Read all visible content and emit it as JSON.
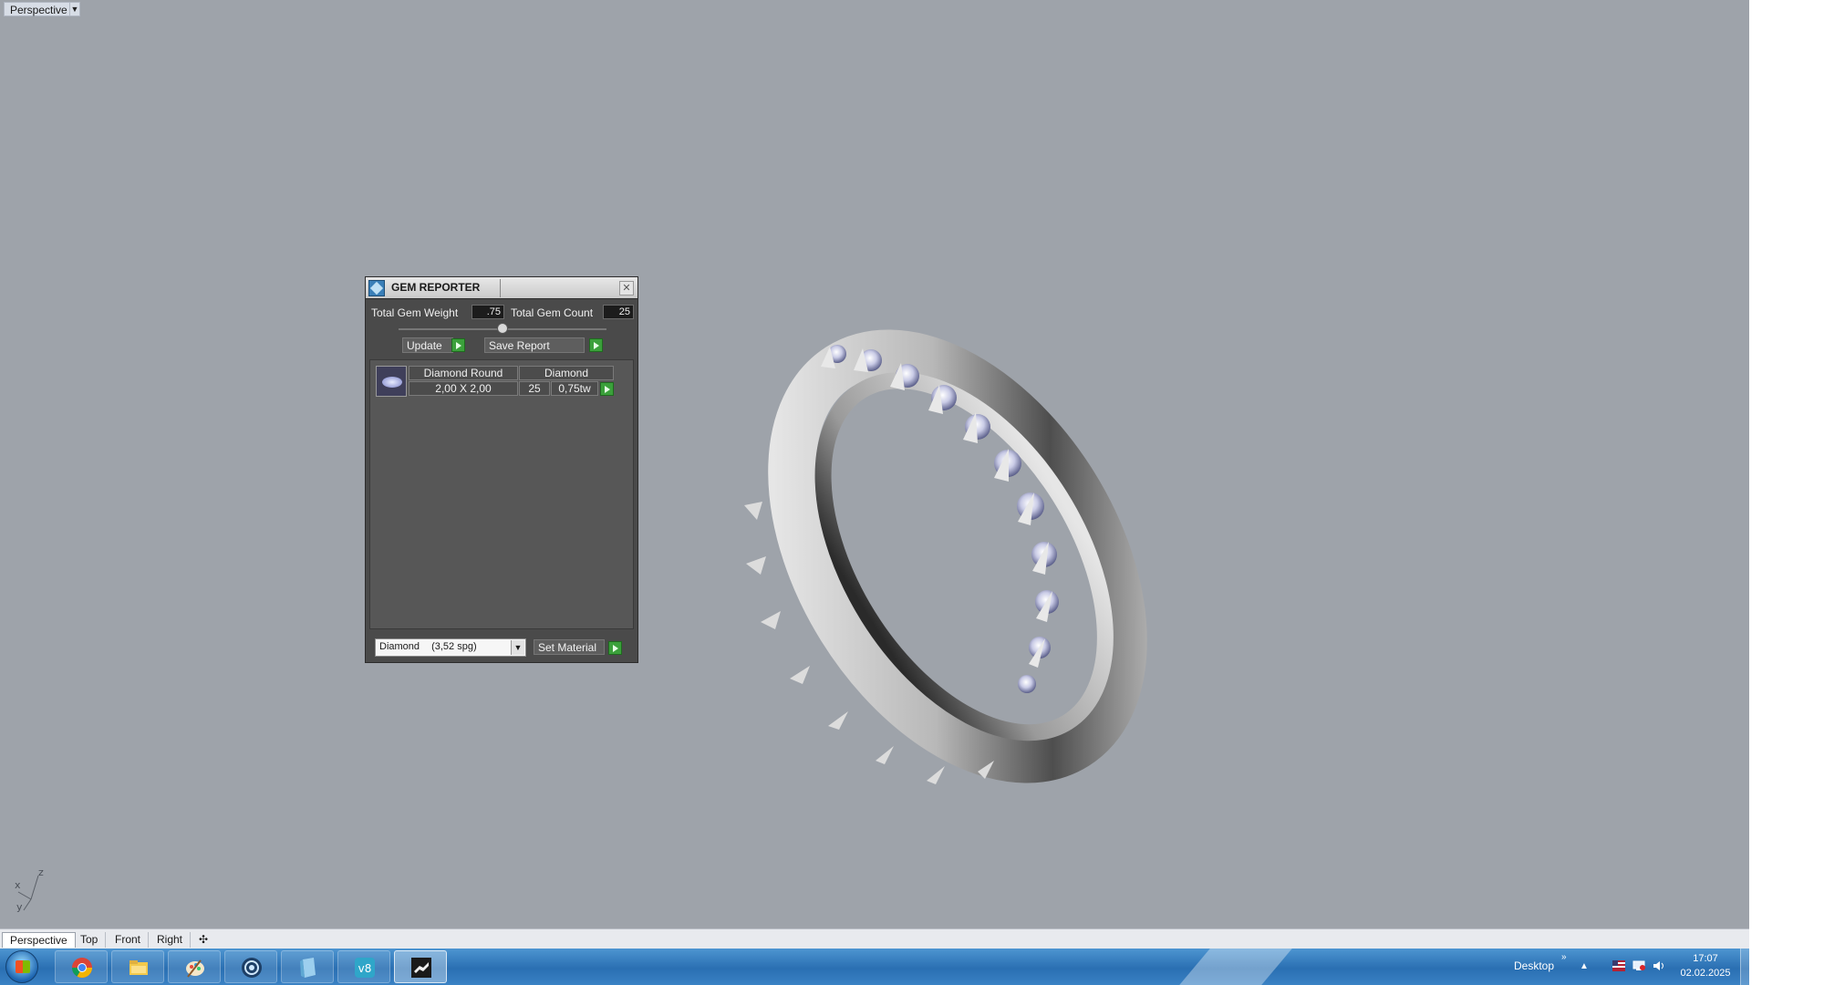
{
  "viewport": {
    "label": "Perspective",
    "axes": {
      "z": "z",
      "x": "x",
      "y": "y"
    }
  },
  "gem_reporter": {
    "title": "GEM REPORTER",
    "total_weight_label": "Total Gem Weight",
    "total_weight_value": ".75",
    "total_count_label": "Total Gem Count",
    "total_count_value": "25",
    "update_label": "Update",
    "save_report_label": "Save Report",
    "rows": [
      {
        "shape": "Diamond Round",
        "size": "2,00 X 2,00",
        "material": "Diamond",
        "count": "25",
        "weight": "0,75tw"
      }
    ],
    "material_select": {
      "name": "Diamond",
      "density": "(3,52 spg)"
    },
    "set_material_label": "Set Material"
  },
  "tabs": [
    "Perspective",
    "Top",
    "Front",
    "Right"
  ],
  "taskbar": {
    "apps": [
      "windows-start",
      "chrome",
      "file-explorer",
      "paint",
      "aperture",
      "document",
      "v8",
      "rhino"
    ],
    "desktop_label": "Desktop",
    "time": "17:07",
    "date": "02.02.2025"
  },
  "colors": {
    "viewport_bg": "#9ea3aa",
    "panel_bg": "#4a4a4a",
    "accent_green": "#3ba03b",
    "taskbar_blue": "#2a6fb2"
  }
}
